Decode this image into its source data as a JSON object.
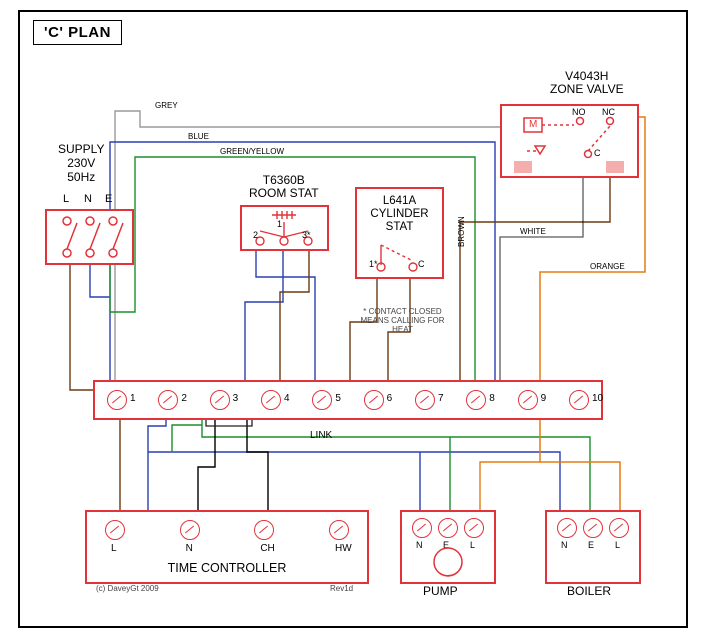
{
  "title": "'C' PLAN",
  "supply": {
    "label": "SUPPLY",
    "voltage": "230V",
    "freq": "50Hz",
    "L": "L",
    "N": "N",
    "E": "E"
  },
  "roomstat": {
    "model": "T6360B",
    "label": "ROOM STAT",
    "p1": "2",
    "p2": "1",
    "p3": "3*"
  },
  "cylstat": {
    "model": "L641A",
    "label": "CYLINDER",
    "label2": "STAT",
    "p1": "1*",
    "p2": "C",
    "note": "* CONTACT CLOSED MEANS CALLING FOR HEAT"
  },
  "zone": {
    "model": "V4043H",
    "label": "ZONE VALVE",
    "M": "M",
    "NO": "NO",
    "NC": "NC",
    "C": "C"
  },
  "bus": {
    "n1": "1",
    "n2": "2",
    "n3": "3",
    "n4": "4",
    "n5": "5",
    "n6": "6",
    "n7": "7",
    "n8": "8",
    "n9": "9",
    "n10": "10",
    "link": "LINK"
  },
  "timectl": {
    "label": "TIME CONTROLLER",
    "L": "L",
    "N": "N",
    "CH": "CH",
    "HW": "HW"
  },
  "pump": {
    "label": "PUMP",
    "N": "N",
    "E": "E",
    "L": "L"
  },
  "boiler": {
    "label": "BOILER",
    "N": "N",
    "E": "E",
    "L": "L"
  },
  "wires": {
    "grey": "GREY",
    "blue": "BLUE",
    "greenyellow": "GREEN/YELLOW",
    "brown": "BROWN",
    "white": "WHITE",
    "orange": "ORANGE"
  },
  "footer": {
    "copyright": "(c) DaveyGt 2009",
    "rev": "Rev1d"
  },
  "colors": {
    "red": "#e2333a",
    "blue": "#2a3fb3",
    "green": "#1a8f2a",
    "brown": "#6b3a12",
    "grey": "#9a9a9a",
    "orange": "#e47d12",
    "black": "#000"
  }
}
